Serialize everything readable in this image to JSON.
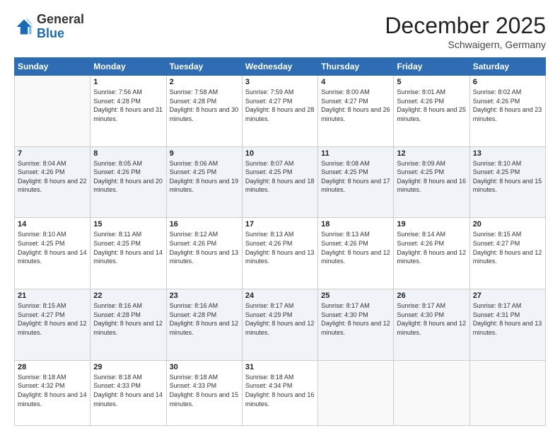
{
  "header": {
    "logo": {
      "general": "General",
      "blue": "Blue"
    },
    "title": "December 2025",
    "location": "Schwaigern, Germany"
  },
  "days_of_week": [
    "Sunday",
    "Monday",
    "Tuesday",
    "Wednesday",
    "Thursday",
    "Friday",
    "Saturday"
  ],
  "weeks": [
    [
      {
        "day": "",
        "sunrise": "",
        "sunset": "",
        "daylight": ""
      },
      {
        "day": "1",
        "sunrise": "Sunrise: 7:56 AM",
        "sunset": "Sunset: 4:28 PM",
        "daylight": "Daylight: 8 hours and 31 minutes."
      },
      {
        "day": "2",
        "sunrise": "Sunrise: 7:58 AM",
        "sunset": "Sunset: 4:28 PM",
        "daylight": "Daylight: 8 hours and 30 minutes."
      },
      {
        "day": "3",
        "sunrise": "Sunrise: 7:59 AM",
        "sunset": "Sunset: 4:27 PM",
        "daylight": "Daylight: 8 hours and 28 minutes."
      },
      {
        "day": "4",
        "sunrise": "Sunrise: 8:00 AM",
        "sunset": "Sunset: 4:27 PM",
        "daylight": "Daylight: 8 hours and 26 minutes."
      },
      {
        "day": "5",
        "sunrise": "Sunrise: 8:01 AM",
        "sunset": "Sunset: 4:26 PM",
        "daylight": "Daylight: 8 hours and 25 minutes."
      },
      {
        "day": "6",
        "sunrise": "Sunrise: 8:02 AM",
        "sunset": "Sunset: 4:26 PM",
        "daylight": "Daylight: 8 hours and 23 minutes."
      }
    ],
    [
      {
        "day": "7",
        "sunrise": "Sunrise: 8:04 AM",
        "sunset": "Sunset: 4:26 PM",
        "daylight": "Daylight: 8 hours and 22 minutes."
      },
      {
        "day": "8",
        "sunrise": "Sunrise: 8:05 AM",
        "sunset": "Sunset: 4:26 PM",
        "daylight": "Daylight: 8 hours and 20 minutes."
      },
      {
        "day": "9",
        "sunrise": "Sunrise: 8:06 AM",
        "sunset": "Sunset: 4:25 PM",
        "daylight": "Daylight: 8 hours and 19 minutes."
      },
      {
        "day": "10",
        "sunrise": "Sunrise: 8:07 AM",
        "sunset": "Sunset: 4:25 PM",
        "daylight": "Daylight: 8 hours and 18 minutes."
      },
      {
        "day": "11",
        "sunrise": "Sunrise: 8:08 AM",
        "sunset": "Sunset: 4:25 PM",
        "daylight": "Daylight: 8 hours and 17 minutes."
      },
      {
        "day": "12",
        "sunrise": "Sunrise: 8:09 AM",
        "sunset": "Sunset: 4:25 PM",
        "daylight": "Daylight: 8 hours and 16 minutes."
      },
      {
        "day": "13",
        "sunrise": "Sunrise: 8:10 AM",
        "sunset": "Sunset: 4:25 PM",
        "daylight": "Daylight: 8 hours and 15 minutes."
      }
    ],
    [
      {
        "day": "14",
        "sunrise": "Sunrise: 8:10 AM",
        "sunset": "Sunset: 4:25 PM",
        "daylight": "Daylight: 8 hours and 14 minutes."
      },
      {
        "day": "15",
        "sunrise": "Sunrise: 8:11 AM",
        "sunset": "Sunset: 4:25 PM",
        "daylight": "Daylight: 8 hours and 14 minutes."
      },
      {
        "day": "16",
        "sunrise": "Sunrise: 8:12 AM",
        "sunset": "Sunset: 4:26 PM",
        "daylight": "Daylight: 8 hours and 13 minutes."
      },
      {
        "day": "17",
        "sunrise": "Sunrise: 8:13 AM",
        "sunset": "Sunset: 4:26 PM",
        "daylight": "Daylight: 8 hours and 13 minutes."
      },
      {
        "day": "18",
        "sunrise": "Sunrise: 8:13 AM",
        "sunset": "Sunset: 4:26 PM",
        "daylight": "Daylight: 8 hours and 12 minutes."
      },
      {
        "day": "19",
        "sunrise": "Sunrise: 8:14 AM",
        "sunset": "Sunset: 4:26 PM",
        "daylight": "Daylight: 8 hours and 12 minutes."
      },
      {
        "day": "20",
        "sunrise": "Sunrise: 8:15 AM",
        "sunset": "Sunset: 4:27 PM",
        "daylight": "Daylight: 8 hours and 12 minutes."
      }
    ],
    [
      {
        "day": "21",
        "sunrise": "Sunrise: 8:15 AM",
        "sunset": "Sunset: 4:27 PM",
        "daylight": "Daylight: 8 hours and 12 minutes."
      },
      {
        "day": "22",
        "sunrise": "Sunrise: 8:16 AM",
        "sunset": "Sunset: 4:28 PM",
        "daylight": "Daylight: 8 hours and 12 minutes."
      },
      {
        "day": "23",
        "sunrise": "Sunrise: 8:16 AM",
        "sunset": "Sunset: 4:28 PM",
        "daylight": "Daylight: 8 hours and 12 minutes."
      },
      {
        "day": "24",
        "sunrise": "Sunrise: 8:17 AM",
        "sunset": "Sunset: 4:29 PM",
        "daylight": "Daylight: 8 hours and 12 minutes."
      },
      {
        "day": "25",
        "sunrise": "Sunrise: 8:17 AM",
        "sunset": "Sunset: 4:30 PM",
        "daylight": "Daylight: 8 hours and 12 minutes."
      },
      {
        "day": "26",
        "sunrise": "Sunrise: 8:17 AM",
        "sunset": "Sunset: 4:30 PM",
        "daylight": "Daylight: 8 hours and 12 minutes."
      },
      {
        "day": "27",
        "sunrise": "Sunrise: 8:17 AM",
        "sunset": "Sunset: 4:31 PM",
        "daylight": "Daylight: 8 hours and 13 minutes."
      }
    ],
    [
      {
        "day": "28",
        "sunrise": "Sunrise: 8:18 AM",
        "sunset": "Sunset: 4:32 PM",
        "daylight": "Daylight: 8 hours and 14 minutes."
      },
      {
        "day": "29",
        "sunrise": "Sunrise: 8:18 AM",
        "sunset": "Sunset: 4:33 PM",
        "daylight": "Daylight: 8 hours and 14 minutes."
      },
      {
        "day": "30",
        "sunrise": "Sunrise: 8:18 AM",
        "sunset": "Sunset: 4:33 PM",
        "daylight": "Daylight: 8 hours and 15 minutes."
      },
      {
        "day": "31",
        "sunrise": "Sunrise: 8:18 AM",
        "sunset": "Sunset: 4:34 PM",
        "daylight": "Daylight: 8 hours and 16 minutes."
      },
      {
        "day": "",
        "sunrise": "",
        "sunset": "",
        "daylight": ""
      },
      {
        "day": "",
        "sunrise": "",
        "sunset": "",
        "daylight": ""
      },
      {
        "day": "",
        "sunrise": "",
        "sunset": "",
        "daylight": ""
      }
    ]
  ]
}
